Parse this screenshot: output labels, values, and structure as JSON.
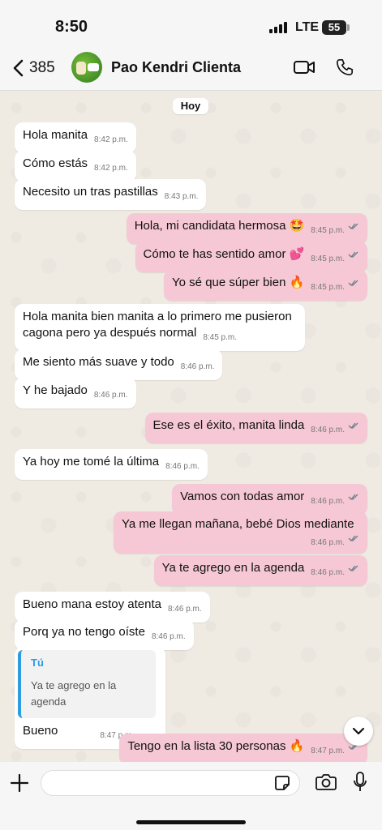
{
  "status_bar": {
    "time": "8:50",
    "network": "LTE",
    "battery": "55"
  },
  "header": {
    "back_count": "385",
    "contact_name": "Pao Kendri Clienta"
  },
  "chat": {
    "date_chip": "Hoy",
    "messages": [
      {
        "dir": "in",
        "text": "Hola manita",
        "time": "8:42 p.m."
      },
      {
        "dir": "in",
        "text": "Cómo estás",
        "time": "8:42 p.m."
      },
      {
        "dir": "in",
        "text": "Necesito un tras pastillas",
        "time": "8:43 p.m."
      },
      {
        "dir": "out",
        "text": "Hola, mi candidata hermosa 🤩",
        "time": "8:45 p.m."
      },
      {
        "dir": "out",
        "text": "Cómo te has sentido amor 💕",
        "time": "8:45 p.m."
      },
      {
        "dir": "out",
        "text": "Yo sé que súper bien 🔥",
        "time": "8:45 p.m."
      },
      {
        "dir": "in",
        "text": "Hola manita bien manita a lo primero me pusieron cagona pero ya después normal",
        "time": "8:45 p.m."
      },
      {
        "dir": "in",
        "text": "Me siento más suave y todo",
        "time": "8:46 p.m."
      },
      {
        "dir": "in",
        "text": "Y he bajado",
        "time": "8:46 p.m."
      },
      {
        "dir": "out",
        "text": "Ese es el éxito, manita linda",
        "time": "8:46 p.m."
      },
      {
        "dir": "in",
        "text": "Ya hoy me tomé la última",
        "time": "8:46 p.m."
      },
      {
        "dir": "out",
        "text": "Vamos con todas amor",
        "time": "8:46 p.m."
      },
      {
        "dir": "out",
        "text": "Ya me llegan mañana, bebé Dios mediante",
        "time": "8:46 p.m."
      },
      {
        "dir": "out",
        "text": "Ya te agrego en la agenda",
        "time": "8:46 p.m."
      },
      {
        "dir": "in",
        "text": "Bueno mana estoy atenta",
        "time": "8:46 p.m."
      },
      {
        "dir": "in",
        "text": "Porq ya no tengo oíste",
        "time": "8:46 p.m."
      },
      {
        "dir": "in",
        "text": "Bueno",
        "time": "8:47 p.m.",
        "reply_author": "Tú",
        "reply_text": "Ya te agrego en la agenda"
      },
      {
        "dir": "out",
        "text": "Tengo en la lista 30 personas 🔥",
        "time": "8:47 p.m."
      }
    ]
  },
  "input_bar": {
    "placeholder": ""
  },
  "colors": {
    "incoming": "#ffffff",
    "outgoing": "#f6c8d6",
    "background": "#efeae2",
    "read_ticks": "#6b7d8a"
  }
}
